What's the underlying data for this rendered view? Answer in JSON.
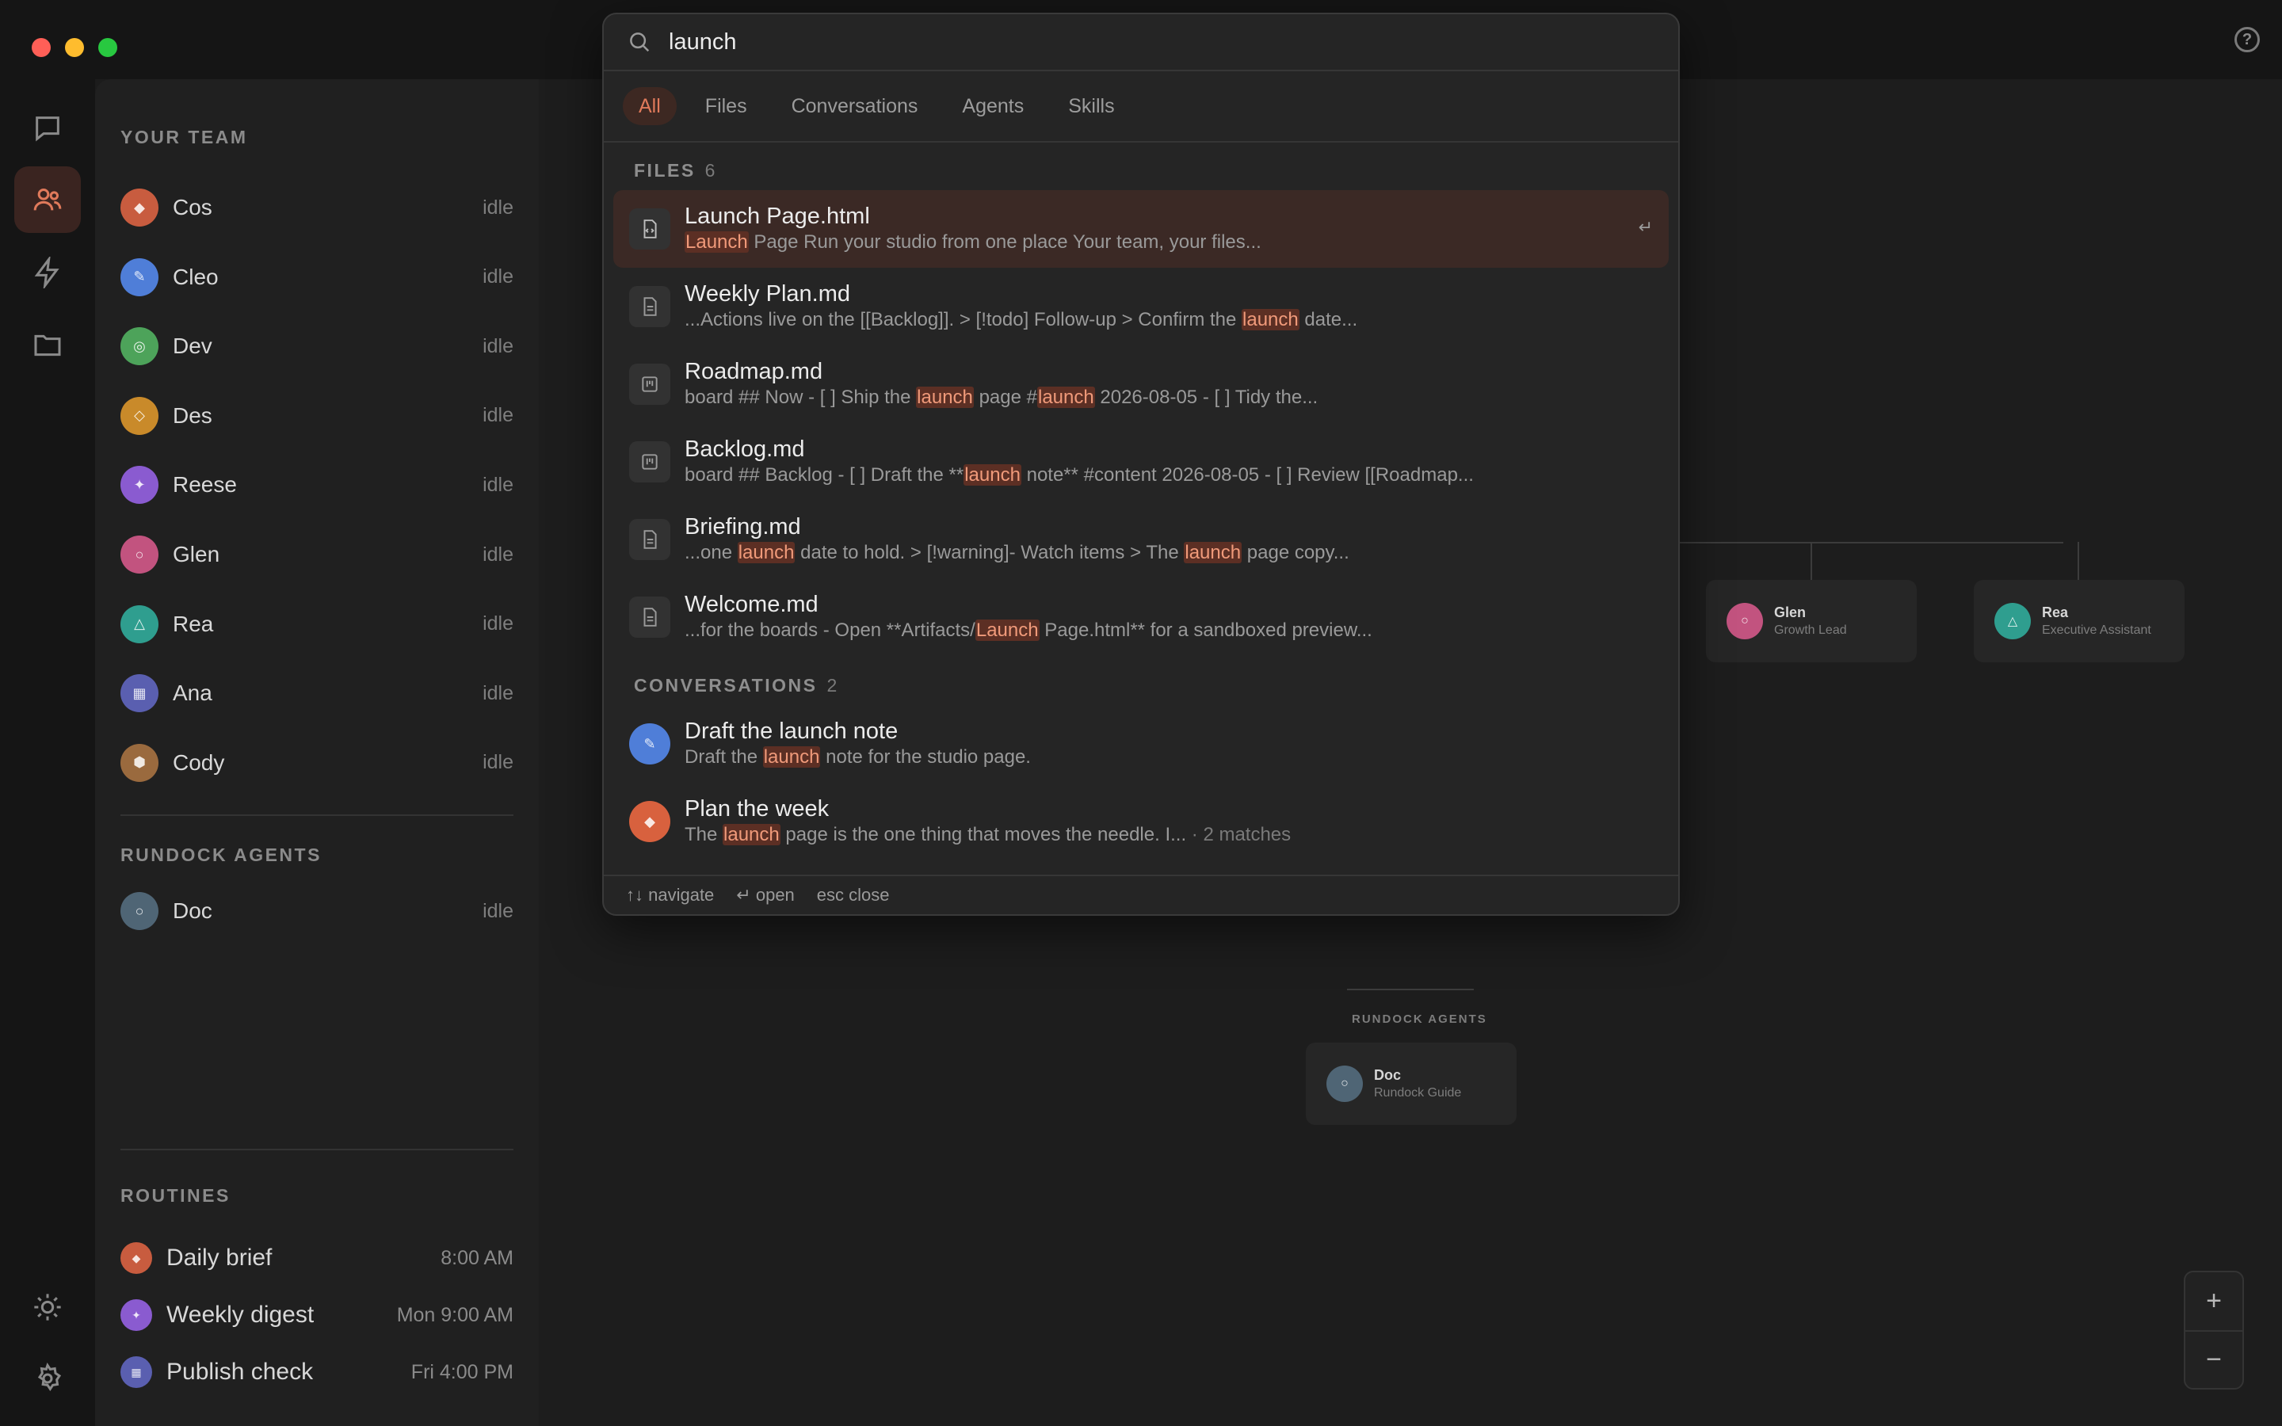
{
  "window": {
    "traffic_colors": [
      "#ff5f57",
      "#febc2e",
      "#28c840"
    ],
    "help_icon": "?"
  },
  "rail": {
    "items": [
      {
        "icon": "chat-icon"
      },
      {
        "icon": "team-icon",
        "active": true
      },
      {
        "icon": "bolt-icon"
      },
      {
        "icon": "folder-icon"
      }
    ],
    "bottom": [
      {
        "icon": "sun-icon"
      },
      {
        "icon": "gear-icon"
      }
    ]
  },
  "sidebar": {
    "team_label": "YOUR TEAM",
    "team": [
      {
        "name": "Cos",
        "status": "idle",
        "color": "#c85c3f",
        "glyph": "◆"
      },
      {
        "name": "Cleo",
        "status": "idle",
        "color": "#4f7ed8",
        "glyph": "✎"
      },
      {
        "name": "Dev",
        "status": "idle",
        "color": "#4da35a",
        "glyph": "◎"
      },
      {
        "name": "Des",
        "status": "idle",
        "color": "#c98a2a",
        "glyph": "◇"
      },
      {
        "name": "Reese",
        "status": "idle",
        "color": "#8a5bd0",
        "glyph": "✦"
      },
      {
        "name": "Glen",
        "status": "idle",
        "color": "#c2537f",
        "glyph": "○"
      },
      {
        "name": "Rea",
        "status": "idle",
        "color": "#2f9e8f",
        "glyph": "△"
      },
      {
        "name": "Ana",
        "status": "idle",
        "color": "#5a5fb0",
        "glyph": "▦"
      },
      {
        "name": "Cody",
        "status": "idle",
        "color": "#9a6a3e",
        "glyph": "⬢"
      }
    ],
    "agents_label": "RUNDOCK AGENTS",
    "agents": [
      {
        "name": "Doc",
        "status": "idle",
        "color": "#4f6575",
        "glyph": "○"
      }
    ],
    "routines_label": "ROUTINES",
    "routines": [
      {
        "name": "Daily brief",
        "time": "8:00 AM",
        "color": "#c85c3f",
        "glyph": "◆"
      },
      {
        "name": "Weekly digest",
        "time": "Mon 9:00 AM",
        "color": "#8a5bd0",
        "glyph": "✦"
      },
      {
        "name": "Publish check",
        "time": "Fri 4:00 PM",
        "color": "#5a5fb0",
        "glyph": "▦"
      }
    ]
  },
  "canvas": {
    "nodes": [
      {
        "name": "Glen",
        "role": "Growth Lead",
        "color": "#c2537f",
        "glyph": "○"
      },
      {
        "name": "Rea",
        "role": "Executive Assistant",
        "color": "#2f9e8f",
        "glyph": "△"
      }
    ],
    "agents_label": "RUNDOCK AGENTS",
    "agent_node": {
      "name": "Doc",
      "role": "Rundock Guide",
      "color": "#4f6575",
      "glyph": "○"
    },
    "zoom_in": "+",
    "zoom_out": "−"
  },
  "search": {
    "query": "launch",
    "tabs": [
      "All",
      "Files",
      "Conversations",
      "Agents",
      "Skills"
    ],
    "active_tab": "All",
    "files_label": "FILES",
    "files_count": "6",
    "files": [
      {
        "title": "Launch Page.html",
        "icon": "code-file-icon",
        "selected": true,
        "snippet": [
          {
            "t": "Launch",
            "hl": true
          },
          {
            "t": " Page Run your studio from one place Your team, your files..."
          }
        ]
      },
      {
        "title": "Weekly Plan.md",
        "icon": "doc-file-icon",
        "snippet": [
          {
            "t": "...Actions live on the [[Backlog]]. > [!todo] Follow-up > Confirm the "
          },
          {
            "t": "launch",
            "hl": true
          },
          {
            "t": " date..."
          }
        ]
      },
      {
        "title": "Roadmap.md",
        "icon": "board-file-icon",
        "snippet": [
          {
            "t": "board ## Now - [ ] Ship the "
          },
          {
            "t": "launch",
            "hl": true
          },
          {
            "t": " page #"
          },
          {
            "t": "launch",
            "hl": true
          },
          {
            "t": " 2026-08-05 - [ ] Tidy the..."
          }
        ]
      },
      {
        "title": "Backlog.md",
        "icon": "board-file-icon",
        "snippet": [
          {
            "t": "board ## Backlog - [ ] Draft the **"
          },
          {
            "t": "launch",
            "hl": true
          },
          {
            "t": " note** #content 2026-08-05 - [ ] Review [[Roadmap..."
          }
        ]
      },
      {
        "title": "Briefing.md",
        "icon": "doc-file-icon",
        "snippet": [
          {
            "t": "...one "
          },
          {
            "t": "launch",
            "hl": true
          },
          {
            "t": " date to hold. > [!warning]- Watch items > The "
          },
          {
            "t": "launch",
            "hl": true
          },
          {
            "t": " page copy..."
          }
        ]
      },
      {
        "title": "Welcome.md",
        "icon": "doc-file-icon",
        "snippet": [
          {
            "t": "...for the boards - Open **Artifacts/"
          },
          {
            "t": "Launch",
            "hl": true
          },
          {
            "t": " Page.html** for a sandboxed preview..."
          }
        ]
      }
    ],
    "conversations_label": "CONVERSATIONS",
    "conversations_count": "2",
    "conversations": [
      {
        "title": "Draft the launch note",
        "color": "#4f7ed8",
        "glyph": "✎",
        "snippet": [
          {
            "t": "Draft the "
          },
          {
            "t": "launch",
            "hl": true
          },
          {
            "t": " note for the studio page."
          }
        ]
      },
      {
        "title": "Plan the week",
        "color": "#d8613e",
        "glyph": "◆",
        "snippet": [
          {
            "t": "The "
          },
          {
            "t": "launch",
            "hl": true
          },
          {
            "t": " page is the one thing that moves the needle. I..."
          },
          {
            "t": " · 2 matches",
            "muted": true
          }
        ]
      }
    ],
    "enter_hint": "↵",
    "footer": {
      "navigate": "↑↓ navigate",
      "open": "↵ open",
      "close": "esc close"
    }
  }
}
